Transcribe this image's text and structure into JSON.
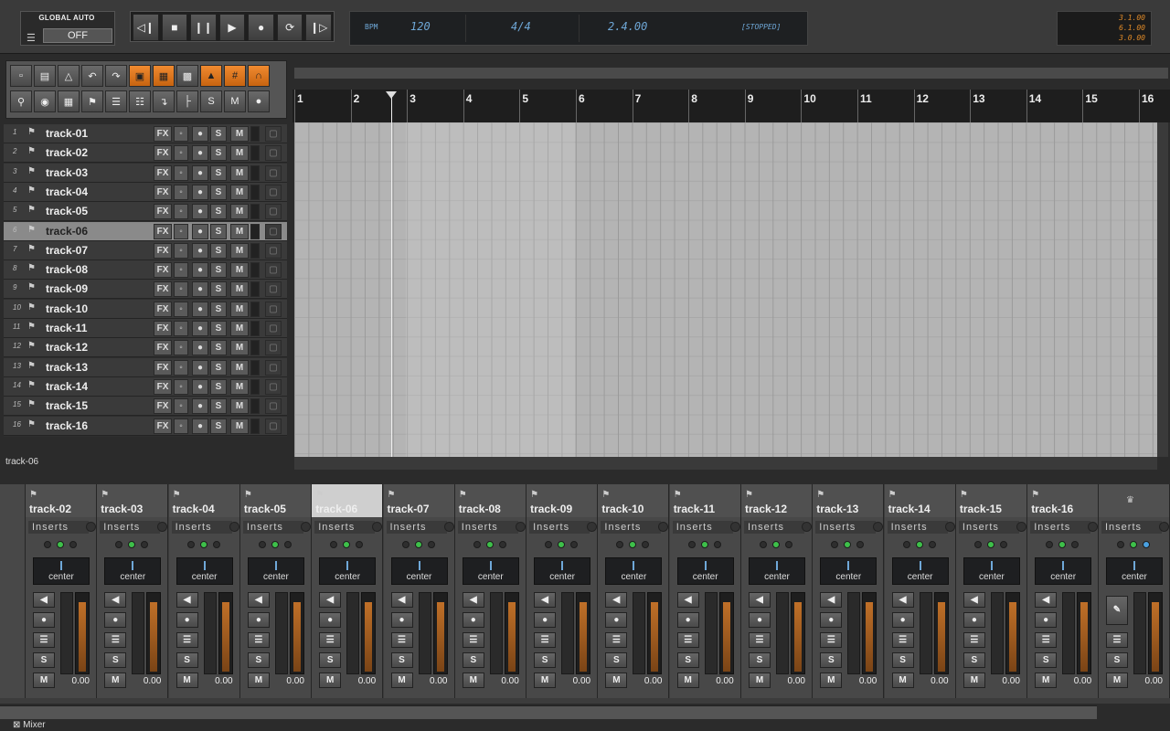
{
  "global_auto": {
    "title": "GLOBAL AUTO",
    "value": "OFF"
  },
  "transport": {
    "buttons": [
      "rewind-icon",
      "stop-icon",
      "pause-icon",
      "play-icon",
      "record-icon",
      "loop-icon",
      "forward-icon"
    ]
  },
  "lcd": {
    "bpm_label": "BPM",
    "bpm": "120",
    "signature": "4/4",
    "position": "2.4.00",
    "status": "[STOPPED]"
  },
  "counters": [
    "3.1.00",
    "6.1.00",
    "3.0.00"
  ],
  "tracks": [
    "track-01",
    "track-02",
    "track-03",
    "track-04",
    "track-05",
    "track-06",
    "track-07",
    "track-08",
    "track-09",
    "track-10",
    "track-11",
    "track-12",
    "track-13",
    "track-14",
    "track-15",
    "track-16"
  ],
  "track_numbers": [
    "1",
    "2",
    "3",
    "4",
    "5",
    "6",
    "7",
    "8",
    "9",
    "10",
    "11",
    "12",
    "13",
    "14",
    "15",
    "16"
  ],
  "track_buttons": {
    "fx": "FX",
    "solo": "S",
    "mute": "M"
  },
  "selected_track": "track-06",
  "ruler": [
    "1",
    "2",
    "3",
    "4",
    "5",
    "6",
    "7",
    "8",
    "9",
    "10",
    "11",
    "12",
    "13",
    "14",
    "15",
    "16"
  ],
  "mixer": {
    "strips": [
      "track-02",
      "track-03",
      "track-04",
      "track-05",
      "track-06",
      "track-07",
      "track-08",
      "track-09",
      "track-10",
      "track-11",
      "track-12",
      "track-13",
      "track-14",
      "track-15",
      "track-16"
    ],
    "inserts_label": "Inserts",
    "pan_label": "center",
    "fader_value": "0.00",
    "solo": "S",
    "mute": "M",
    "title": "Mixer"
  },
  "colors": {
    "accent": "#e8821e",
    "lcd": "#6fa8d8",
    "led": "#3ec04a"
  }
}
